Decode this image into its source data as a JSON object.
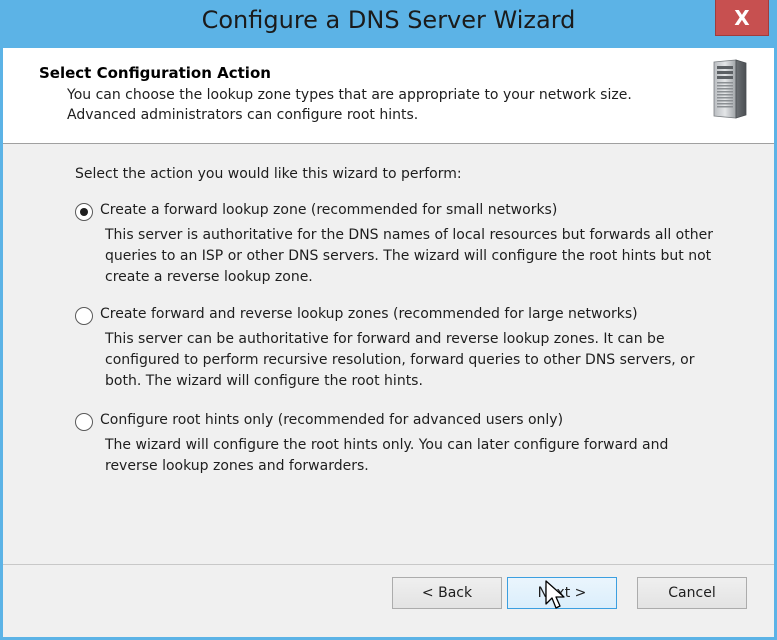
{
  "window": {
    "title": "Configure a DNS Server Wizard",
    "close_label": "X"
  },
  "header": {
    "title": "Select Configuration Action",
    "description_line1": "You can choose the lookup zone types that are appropriate to your network size.",
    "description_line2": "Advanced administrators can configure root hints.",
    "icon": "server-icon"
  },
  "main": {
    "prompt": "Select the action you would like this wizard to perform:",
    "options": [
      {
        "label": "Create a forward lookup zone (recommended for small networks)",
        "description": "This server is authoritative for the DNS names of local resources but forwards all other queries to an ISP or other DNS servers. The wizard will configure the root hints but not create a reverse lookup zone.",
        "selected": true
      },
      {
        "label": "Create forward and reverse lookup zones (recommended for large networks)",
        "description": "This server can be authoritative for forward and reverse lookup zones. It can be configured to perform recursive resolution, forward queries to other DNS servers, or both. The wizard will configure the root hints.",
        "selected": false
      },
      {
        "label": "Configure root hints only (recommended for advanced users only)",
        "description": "The wizard will configure the root hints only. You can later configure forward and reverse lookup zones and forwarders.",
        "selected": false
      }
    ]
  },
  "footer": {
    "back_label": "< Back",
    "next_label": "Next >",
    "cancel_label": "Cancel"
  },
  "colors": {
    "title_bar": "#5cb3e6",
    "close_button": "#c75050",
    "dialog_background": "#f0f0f0",
    "focused_button_border": "#3c9fe0"
  }
}
